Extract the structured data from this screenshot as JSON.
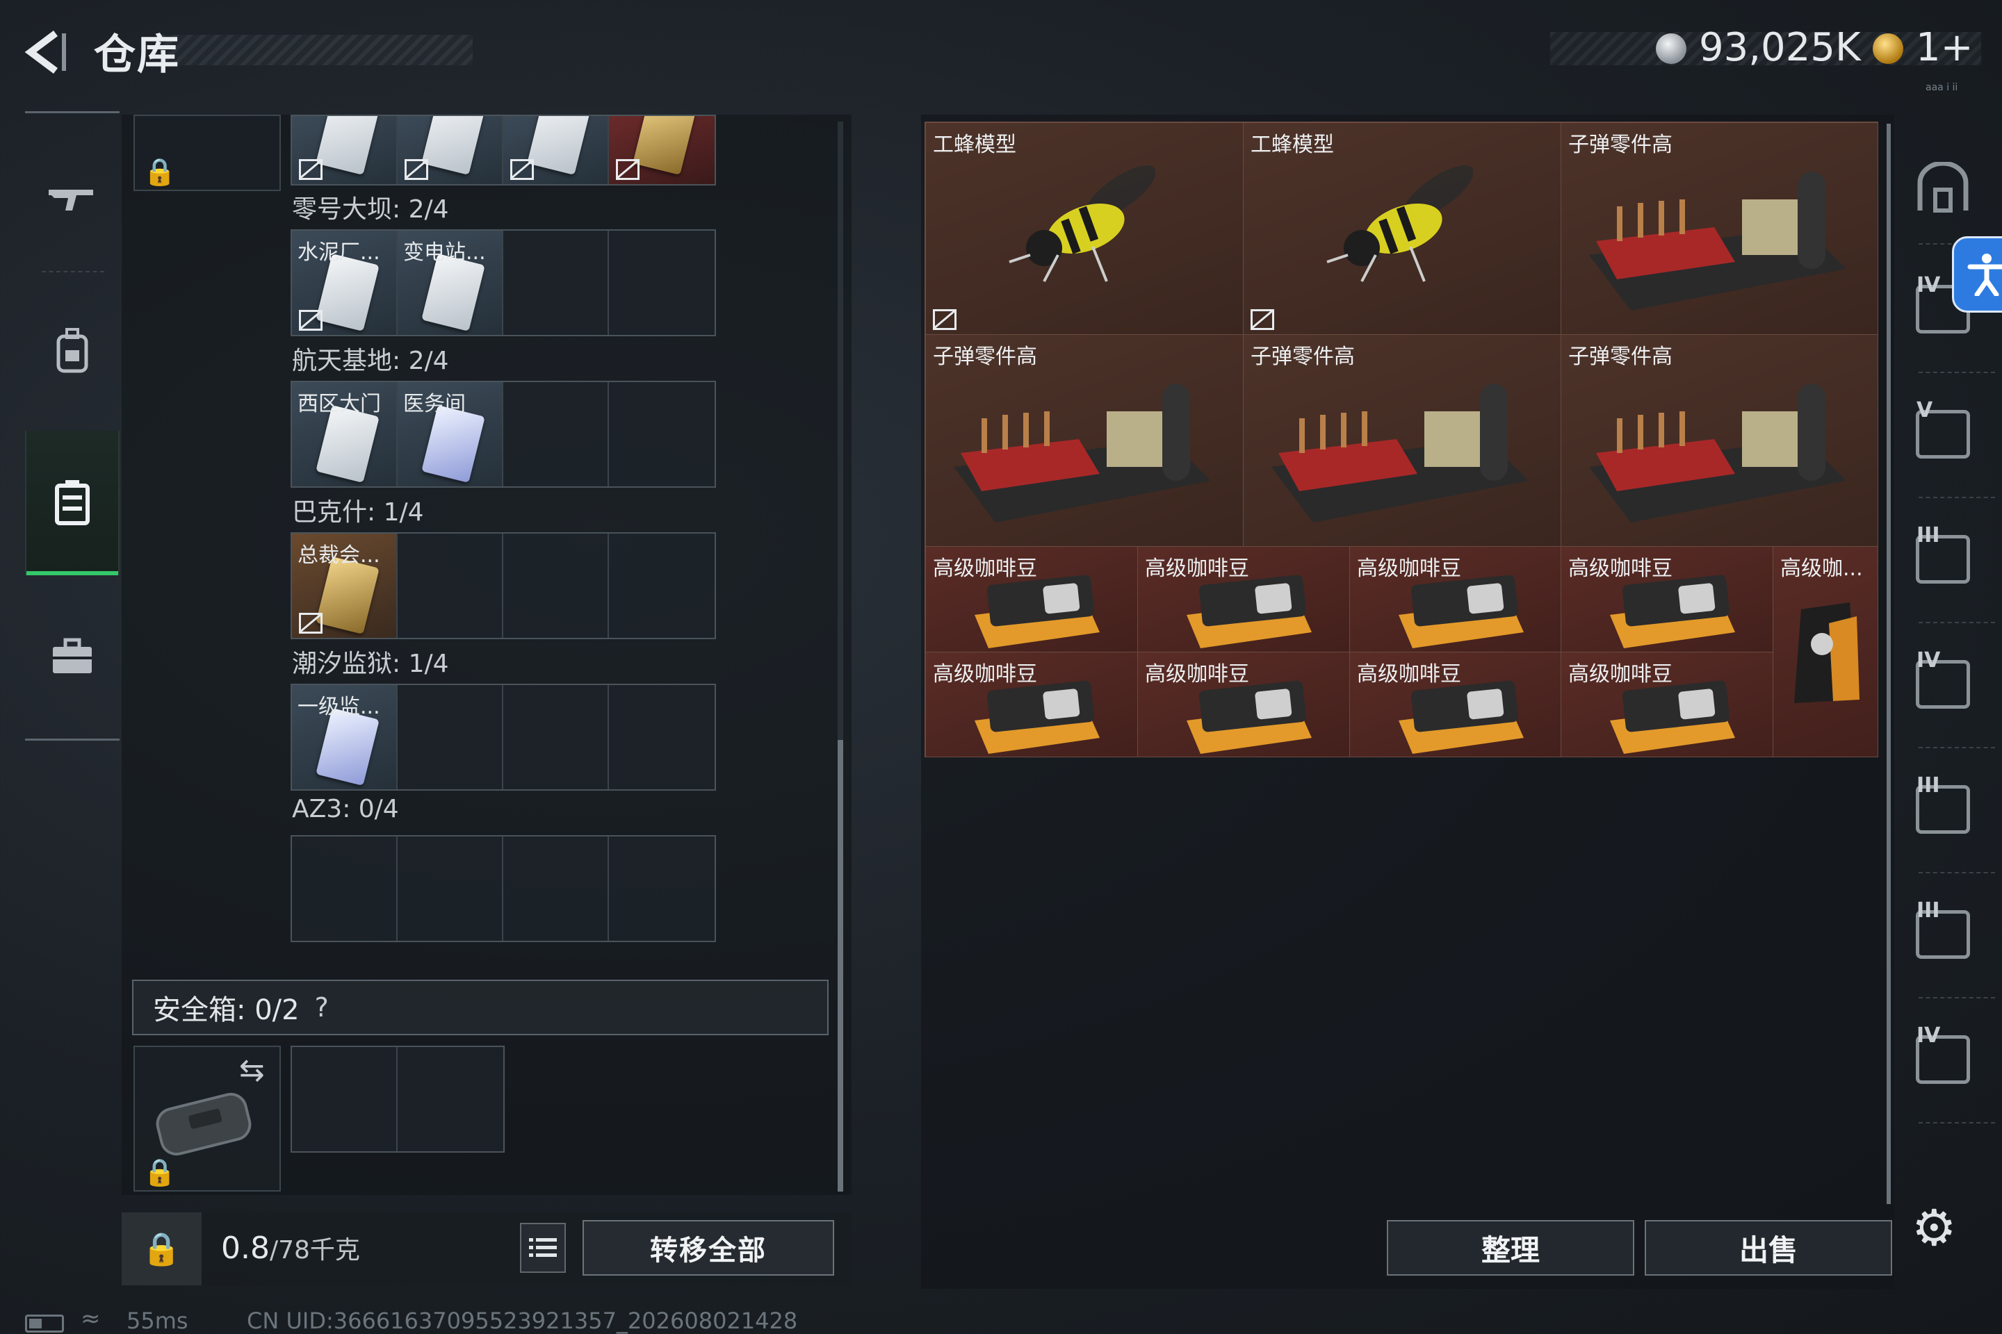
{
  "header": {
    "title": "仓库",
    "currency_amount": "93,025K",
    "secondary_currency": "1+",
    "tiny_text": "aaa i ii"
  },
  "colors": {
    "accent_green": "#34c76b",
    "item_bg_brown": "#4b2d27",
    "accessibility_blue": "#2d7be0"
  },
  "left_nav": {
    "items": [
      {
        "name": "weapons",
        "icon": "rifle-icon"
      },
      {
        "name": "backpack",
        "icon": "backpack-icon"
      },
      {
        "name": "keys",
        "icon": "key-case-icon",
        "active": true
      },
      {
        "name": "toolbox",
        "icon": "briefcase-icon"
      }
    ]
  },
  "key_sections": [
    {
      "label": "零号大坝: 2/4",
      "slots": [
        "水泥厂...",
        "变电站..."
      ]
    },
    {
      "label": "航天基地: 2/4",
      "slots": [
        "西区大门",
        "医务间"
      ]
    },
    {
      "label": "巴克什: 1/4",
      "slots": [
        "总裁会..."
      ]
    },
    {
      "label": "潮汐监狱: 1/4",
      "slots": [
        "一级监..."
      ]
    },
    {
      "label": "AZ3: 0/4",
      "slots": []
    }
  ],
  "safebox": {
    "label": "安全箱: 0/2",
    "help": "?"
  },
  "bottom_left": {
    "weight_value": "0.8",
    "weight_unit": "/78千克",
    "transfer_label": "转移全部"
  },
  "stash_items": {
    "big": [
      "工蜂模型",
      "工蜂模型",
      "子弹零件高",
      "子弹零件高",
      "子弹零件高",
      "子弹零件高"
    ],
    "small": [
      "高级咖啡豆",
      "高级咖啡豆",
      "高级咖啡豆",
      "高级咖啡豆",
      "高级咖...",
      "高级咖啡豆",
      "高级咖啡豆",
      "高级咖啡豆",
      "高级咖啡豆"
    ]
  },
  "bottom_right": {
    "sort_label": "整理",
    "sell_label": "出售"
  },
  "right_nav": {
    "tiers": [
      "",
      "IV",
      "V",
      "III",
      "IV",
      "III",
      "III",
      "IV"
    ]
  },
  "status_bar": {
    "ping": "55ms",
    "uid": "CN UID:3666163709552392135​7_202608021428"
  }
}
